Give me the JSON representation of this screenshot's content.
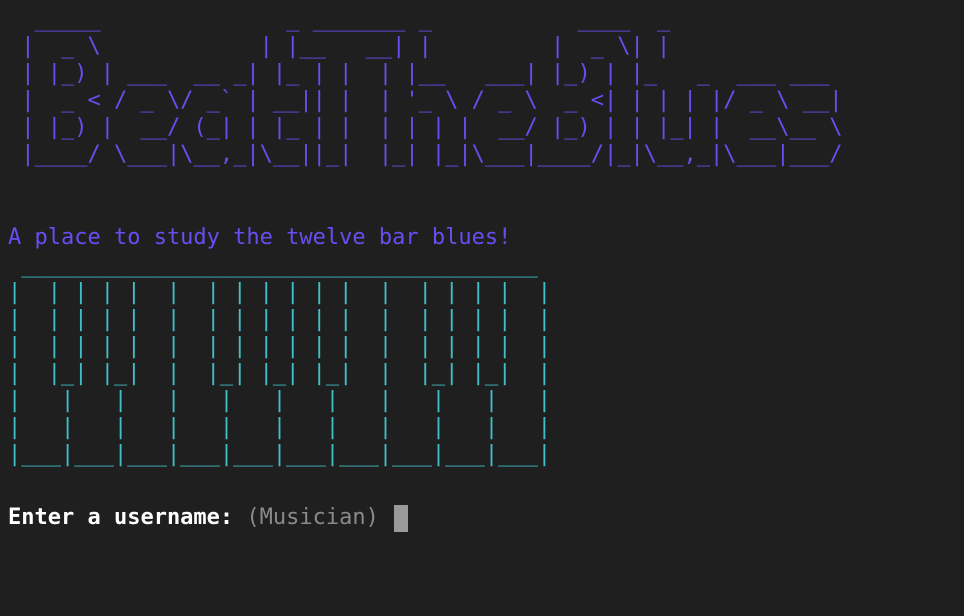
{
  "banner": {
    "art": "  _____              _ _______ _           ____  _            \n |  _ \\            | |__   __| |         |  _ \\| |           \n | |_) | ___  __ _| |_ | |  | |__   ___| |_) | |_   _  ___ ___ \n |  _ < / _ \\/ _` | __|| |  | '_ \\ / _ \\  _ <| | | | |/ _ \\ __|\n | |_) |  __/ (_| | |_ | |  | | | |  __/ |_) | | |_| |  __\\__ \\\n |____/ \\___|\\__,_|\\__||_|  |_| |_|\\___|____/|_|\\__,_|\\___|___/",
    "color": "#6a4df0"
  },
  "tagline": {
    "text": "A place to study the twelve bar blues!",
    "color": "#6a4df0"
  },
  "keyboard": {
    "art": " _______________________________________\n|  | | | |  |  | | | | | |  |  | | | |  |\n|  | | | |  |  | | | | | |  |  | | | |  |\n|  | | | |  |  | | | | | |  |  | | | |  |\n|  |_| |_|  |  |_| |_| |_|  |  |_| |_|  |\n|   |   |   |   |   |   |   |   |   |   |\n|   |   |   |   |   |   |   |   |   |   |\n|___|___|___|___|___|___|___|___|___|___|",
    "color": "#3fbfc7"
  },
  "prompt": {
    "label": "Enter a username:",
    "default_value": "(Musician)"
  }
}
